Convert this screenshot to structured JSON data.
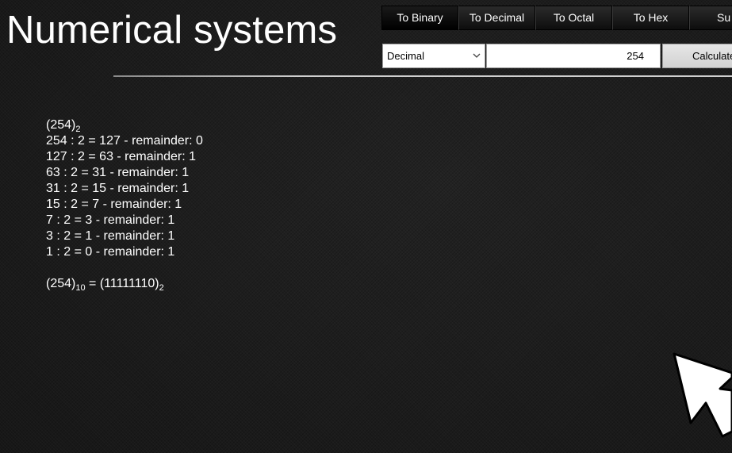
{
  "header": {
    "title": "Numerical systems"
  },
  "tabs": [
    {
      "label": "To Binary",
      "active": true
    },
    {
      "label": "To Decimal",
      "active": false
    },
    {
      "label": "To Octal",
      "active": false
    },
    {
      "label": "To Hex",
      "active": false
    },
    {
      "label": "Su",
      "active": false
    }
  ],
  "form": {
    "base_select": "Decimal",
    "number_value": "254",
    "calculate_label": "Calculate"
  },
  "solution": {
    "header": {
      "number": "(254)",
      "base": "2"
    },
    "steps": [
      "254 : 2 = 127 - remainder: 0",
      "127 : 2 = 63 - remainder: 1",
      "63 : 2 = 31 - remainder: 1",
      "31 : 2 = 15 - remainder: 1",
      "15 : 2 = 7 - remainder: 1",
      "7 : 2 = 3 - remainder: 1",
      "3 : 2 = 1 - remainder: 1",
      "1 : 2 = 0 - remainder: 1"
    ],
    "result": {
      "from_number": "(254)",
      "from_base": "10",
      "equals": " = ",
      "to_number": "(11111110)",
      "to_base": "2"
    }
  },
  "icons": {
    "select_chevron": "chevron-down-icon",
    "pointer": "mouse-pointer-icon"
  },
  "colors": {
    "background": "#1c1c1c",
    "text": "#ffffff",
    "button": "#e0e0e0"
  }
}
